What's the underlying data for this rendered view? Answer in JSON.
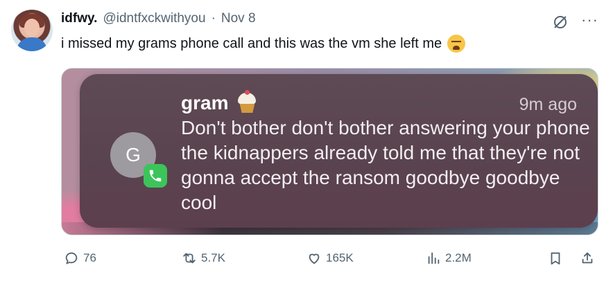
{
  "tweet": {
    "display_name": "idfwy.",
    "handle": "@idntfxckwithyou",
    "separator": "·",
    "date": "Nov 8",
    "text": "i missed my grams phone call and this was the vm she left me",
    "emoji": "loudly-crying-face"
  },
  "notification": {
    "sender": "gram",
    "sender_emoji": "cupcake",
    "time": "9m ago",
    "message": "Don't bother don't bother answering your phone the kidnappers already told me that they're not gonna accept the ransom goodbye goodbye cool",
    "avatar_letter": "G",
    "badge_icon": "phone-icon"
  },
  "actions": {
    "replies": "76",
    "reposts": "5.7K",
    "likes": "165K",
    "views": "2.2M"
  },
  "colors": {
    "text_primary": "#0f1419",
    "text_secondary": "#536471",
    "notification_bg": "#5a4450",
    "phone_badge": "#3cc45b"
  }
}
